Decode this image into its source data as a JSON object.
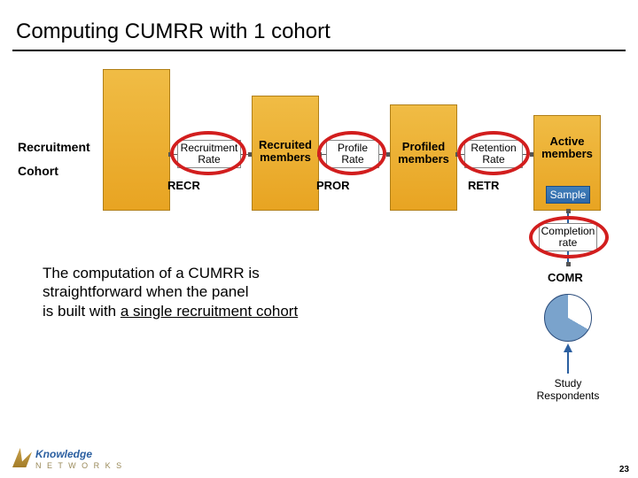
{
  "title": "Computing CUMRR with 1 cohort",
  "leftlabels": {
    "recruitment": "Recruitment",
    "cohort": "Cohort"
  },
  "bars": {
    "recruited": "Recruited\nmembers",
    "profiled": "Profiled\nmembers",
    "active": "Active\nmembers"
  },
  "rates": {
    "recruitment": "Recruitment\nRate",
    "profile": "Profile\nRate",
    "retention": "Retention\nRate",
    "completion": "Completion\nrate"
  },
  "codes": {
    "recr": "RECR",
    "pror": "PROR",
    "retr": "RETR",
    "comr": "COMR"
  },
  "sample_label": "Sample",
  "body": {
    "l1": "The computation of a CUMRR is",
    "l2": "straightforward when the panel",
    "l3a": "is built with ",
    "l3u": "a single recruitment cohort"
  },
  "foot": "Study\nRespondents",
  "page": "23",
  "logo": {
    "brand": "Knowledge",
    "sub": "N E T W O R K S"
  }
}
